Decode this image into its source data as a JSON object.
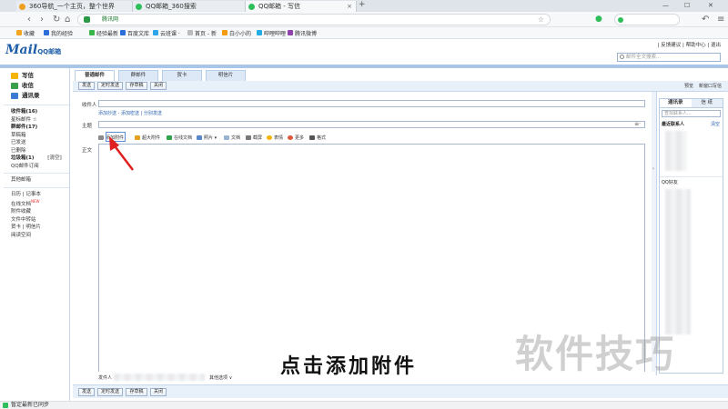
{
  "browser": {
    "tabs": [
      {
        "title": "360导航_一个主页，整个世界"
      },
      {
        "title": "QQ邮箱_360搜索"
      },
      {
        "title": "QQ邮箱 - 写信"
      }
    ],
    "new_tab": "+",
    "address": "腾讯网",
    "bookmarks": [
      "收藏",
      "我的经验",
      "经验最新",
      "百度文库",
      "云班课 ·",
      "首页 - 新",
      "白小小的",
      "哔哩哔哩",
      "腾讯微博"
    ]
  },
  "mail": {
    "logo": "Mail",
    "logo_sub": "QQ邮箱",
    "top_links": "| 反馈建议 | 帮助中心 | 退出",
    "search_placeholder": "邮件全文搜索...",
    "sidebar": {
      "top": [
        "写信",
        "收信",
        "通讯录"
      ],
      "folders": [
        "收件箱(16)",
        "星标邮件 ☆",
        "群邮件(17)",
        "草稿箱",
        "已发送",
        "已删除",
        "垃圾箱(1)",
        "QQ邮件订阅"
      ],
      "folders_right": "[清空]",
      "other": "其他邮箱",
      "apps": [
        "日历 | 记事本",
        "在线文档",
        "附件收藏",
        "文件中转站",
        "贺卡 | 明信片",
        "阅读空间"
      ],
      "new_badge": "NEW"
    },
    "tabs": [
      "普通邮件",
      "群邮件",
      "贺卡",
      "明信片"
    ],
    "toolbar": [
      "发送",
      "定时发送",
      "存草稿",
      "关闭"
    ],
    "toolbar_right": [
      "预览",
      "新窗口写信"
    ],
    "fields": {
      "to": "收件人",
      "subject": "主题",
      "body": "正文"
    },
    "sublinks": "添加抄送 - 添加密送 | 分别发送",
    "editor_tools": [
      "添加附件",
      "超大附件",
      "在线文档",
      "照片",
      "文档",
      "截屏",
      "表情",
      "更多",
      "格式"
    ],
    "contacts": {
      "tabs": [
        "通讯录",
        "信 纸"
      ],
      "search": "查找联系人...",
      "recent": "最近联系人",
      "clear": "清空",
      "qq_friends": "QQ好友"
    },
    "bottom": {
      "sender_label": "发件人",
      "other_options": "其他选项 ∨"
    },
    "status": "暂定最新已同步"
  },
  "overlay": {
    "subtitle": "点击添加附件",
    "watermark": "软件技巧"
  }
}
